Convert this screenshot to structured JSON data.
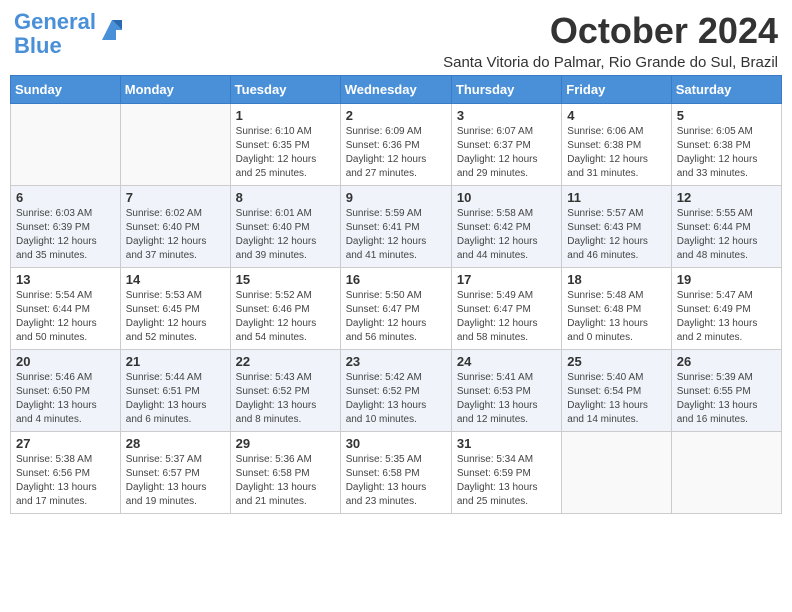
{
  "logo": {
    "line1": "General",
    "line2": "Blue"
  },
  "title": "October 2024",
  "location": "Santa Vitoria do Palmar, Rio Grande do Sul, Brazil",
  "days_of_week": [
    "Sunday",
    "Monday",
    "Tuesday",
    "Wednesday",
    "Thursday",
    "Friday",
    "Saturday"
  ],
  "weeks": [
    [
      {
        "day": "",
        "info": ""
      },
      {
        "day": "",
        "info": ""
      },
      {
        "day": "1",
        "info": "Sunrise: 6:10 AM\nSunset: 6:35 PM\nDaylight: 12 hours\nand 25 minutes."
      },
      {
        "day": "2",
        "info": "Sunrise: 6:09 AM\nSunset: 6:36 PM\nDaylight: 12 hours\nand 27 minutes."
      },
      {
        "day": "3",
        "info": "Sunrise: 6:07 AM\nSunset: 6:37 PM\nDaylight: 12 hours\nand 29 minutes."
      },
      {
        "day": "4",
        "info": "Sunrise: 6:06 AM\nSunset: 6:38 PM\nDaylight: 12 hours\nand 31 minutes."
      },
      {
        "day": "5",
        "info": "Sunrise: 6:05 AM\nSunset: 6:38 PM\nDaylight: 12 hours\nand 33 minutes."
      }
    ],
    [
      {
        "day": "6",
        "info": "Sunrise: 6:03 AM\nSunset: 6:39 PM\nDaylight: 12 hours\nand 35 minutes."
      },
      {
        "day": "7",
        "info": "Sunrise: 6:02 AM\nSunset: 6:40 PM\nDaylight: 12 hours\nand 37 minutes."
      },
      {
        "day": "8",
        "info": "Sunrise: 6:01 AM\nSunset: 6:40 PM\nDaylight: 12 hours\nand 39 minutes."
      },
      {
        "day": "9",
        "info": "Sunrise: 5:59 AM\nSunset: 6:41 PM\nDaylight: 12 hours\nand 41 minutes."
      },
      {
        "day": "10",
        "info": "Sunrise: 5:58 AM\nSunset: 6:42 PM\nDaylight: 12 hours\nand 44 minutes."
      },
      {
        "day": "11",
        "info": "Sunrise: 5:57 AM\nSunset: 6:43 PM\nDaylight: 12 hours\nand 46 minutes."
      },
      {
        "day": "12",
        "info": "Sunrise: 5:55 AM\nSunset: 6:44 PM\nDaylight: 12 hours\nand 48 minutes."
      }
    ],
    [
      {
        "day": "13",
        "info": "Sunrise: 5:54 AM\nSunset: 6:44 PM\nDaylight: 12 hours\nand 50 minutes."
      },
      {
        "day": "14",
        "info": "Sunrise: 5:53 AM\nSunset: 6:45 PM\nDaylight: 12 hours\nand 52 minutes."
      },
      {
        "day": "15",
        "info": "Sunrise: 5:52 AM\nSunset: 6:46 PM\nDaylight: 12 hours\nand 54 minutes."
      },
      {
        "day": "16",
        "info": "Sunrise: 5:50 AM\nSunset: 6:47 PM\nDaylight: 12 hours\nand 56 minutes."
      },
      {
        "day": "17",
        "info": "Sunrise: 5:49 AM\nSunset: 6:47 PM\nDaylight: 12 hours\nand 58 minutes."
      },
      {
        "day": "18",
        "info": "Sunrise: 5:48 AM\nSunset: 6:48 PM\nDaylight: 13 hours\nand 0 minutes."
      },
      {
        "day": "19",
        "info": "Sunrise: 5:47 AM\nSunset: 6:49 PM\nDaylight: 13 hours\nand 2 minutes."
      }
    ],
    [
      {
        "day": "20",
        "info": "Sunrise: 5:46 AM\nSunset: 6:50 PM\nDaylight: 13 hours\nand 4 minutes."
      },
      {
        "day": "21",
        "info": "Sunrise: 5:44 AM\nSunset: 6:51 PM\nDaylight: 13 hours\nand 6 minutes."
      },
      {
        "day": "22",
        "info": "Sunrise: 5:43 AM\nSunset: 6:52 PM\nDaylight: 13 hours\nand 8 minutes."
      },
      {
        "day": "23",
        "info": "Sunrise: 5:42 AM\nSunset: 6:52 PM\nDaylight: 13 hours\nand 10 minutes."
      },
      {
        "day": "24",
        "info": "Sunrise: 5:41 AM\nSunset: 6:53 PM\nDaylight: 13 hours\nand 12 minutes."
      },
      {
        "day": "25",
        "info": "Sunrise: 5:40 AM\nSunset: 6:54 PM\nDaylight: 13 hours\nand 14 minutes."
      },
      {
        "day": "26",
        "info": "Sunrise: 5:39 AM\nSunset: 6:55 PM\nDaylight: 13 hours\nand 16 minutes."
      }
    ],
    [
      {
        "day": "27",
        "info": "Sunrise: 5:38 AM\nSunset: 6:56 PM\nDaylight: 13 hours\nand 17 minutes."
      },
      {
        "day": "28",
        "info": "Sunrise: 5:37 AM\nSunset: 6:57 PM\nDaylight: 13 hours\nand 19 minutes."
      },
      {
        "day": "29",
        "info": "Sunrise: 5:36 AM\nSunset: 6:58 PM\nDaylight: 13 hours\nand 21 minutes."
      },
      {
        "day": "30",
        "info": "Sunrise: 5:35 AM\nSunset: 6:58 PM\nDaylight: 13 hours\nand 23 minutes."
      },
      {
        "day": "31",
        "info": "Sunrise: 5:34 AM\nSunset: 6:59 PM\nDaylight: 13 hours\nand 25 minutes."
      },
      {
        "day": "",
        "info": ""
      },
      {
        "day": "",
        "info": ""
      }
    ]
  ]
}
